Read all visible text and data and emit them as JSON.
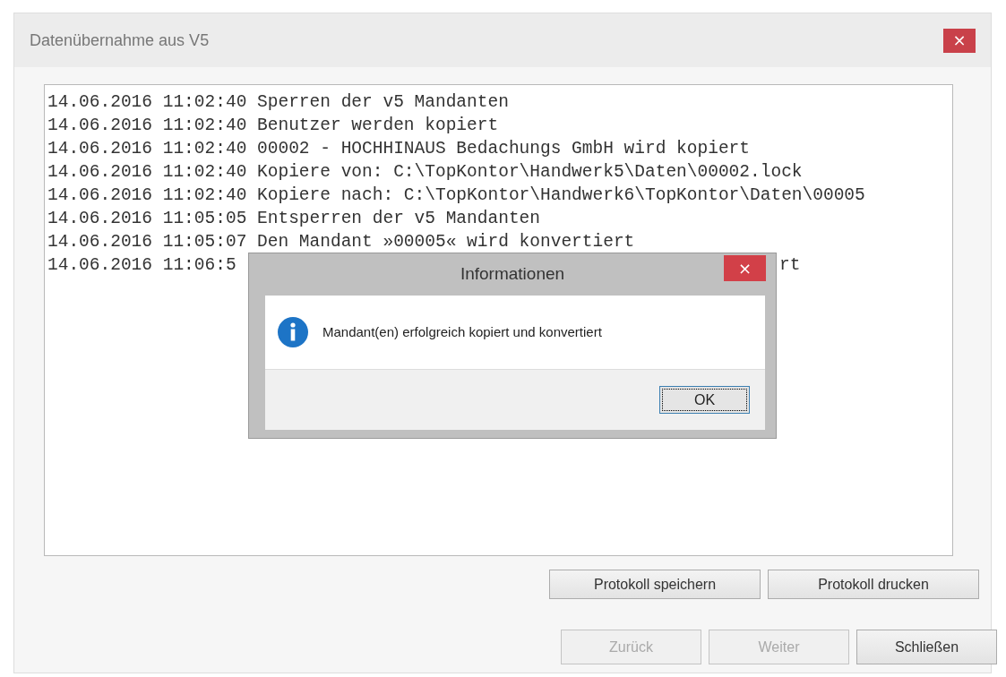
{
  "window": {
    "title": "Datenübernahme aus V5",
    "close": "×"
  },
  "log": [
    {
      "text": "14.06.2016 11:02:40 Sperren der v5 Mandanten"
    },
    {
      "text": "14.06.2016 11:02:40 Benutzer werden kopiert"
    },
    {
      "text": "14.06.2016 11:02:40 00002 - HOCHHINAUS Bedachungs GmbH wird kopiert"
    },
    {
      "text": "14.06.2016 11:02:40 Kopiere von: C:\\TopKontor\\Handwerk5\\Daten\\00002.lock"
    },
    {
      "text": "14.06.2016 11:02:40 Kopiere nach: C:\\TopKontor\\Handwerk6\\TopKontor\\Daten\\00005"
    },
    {
      "text": "14.06.2016 11:05:05 Entsperren der v5 Mandanten"
    },
    {
      "text": "14.06.2016 11:05:07 Den Mandant »00005« wird konvertiert"
    },
    {
      "text": "14.06.2016 11:06:5",
      "tail": "rt"
    }
  ],
  "log_buttons": [
    {
      "label": "Protokoll speichern",
      "disabled": false
    },
    {
      "label": "Protokoll drucken",
      "disabled": false
    }
  ],
  "nav_buttons": [
    {
      "label": "Zurück",
      "disabled": true
    },
    {
      "label": "Weiter",
      "disabled": true
    },
    {
      "label": "Schließen",
      "disabled": false
    }
  ],
  "dialog": {
    "title": "Informationen",
    "close": "×",
    "message": "Mandant(en) erfolgreich kopiert und konvertiert",
    "ok": {
      "label": "OK",
      "focused": true
    }
  }
}
